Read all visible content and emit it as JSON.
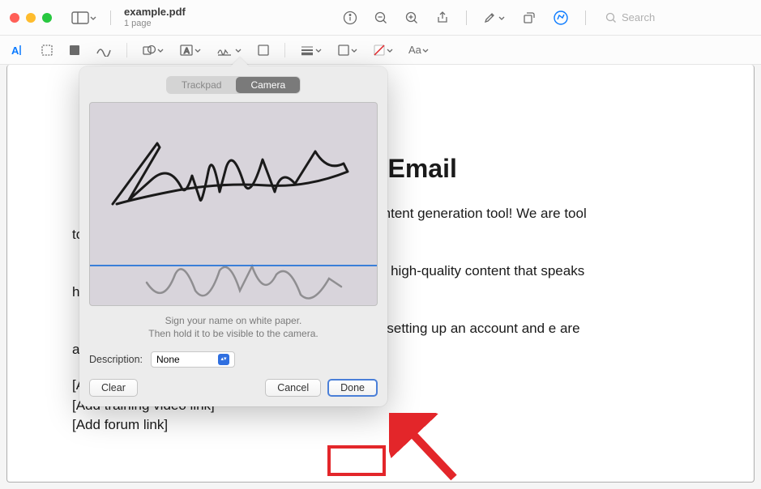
{
  "window": {
    "title": "example.pdf",
    "subtitle": "1 page",
    "search_placeholder": "Search"
  },
  "markup": {
    "font_label": "Aa"
  },
  "doc": {
    "title_visible": "on Email",
    "p1": "d content generation tool! We are tool to create the content you need.",
    "p2": "ging, high-quality content that speaks hnology enables you to generate before.",
    "p3": "n by setting up an account and e are a few helpful resources to get",
    "links": [
      "[Add website link]",
      "[Add training video link]",
      "[Add forum link]"
    ]
  },
  "popover": {
    "tabs": {
      "trackpad": "Trackpad",
      "camera": "Camera"
    },
    "instruction1": "Sign your name on white paper.",
    "instruction2": "Then hold it to be visible to the camera.",
    "description_label": "Description:",
    "description_value": "None",
    "buttons": {
      "clear": "Clear",
      "cancel": "Cancel",
      "done": "Done"
    },
    "signature_name": "Robinson Clark"
  }
}
